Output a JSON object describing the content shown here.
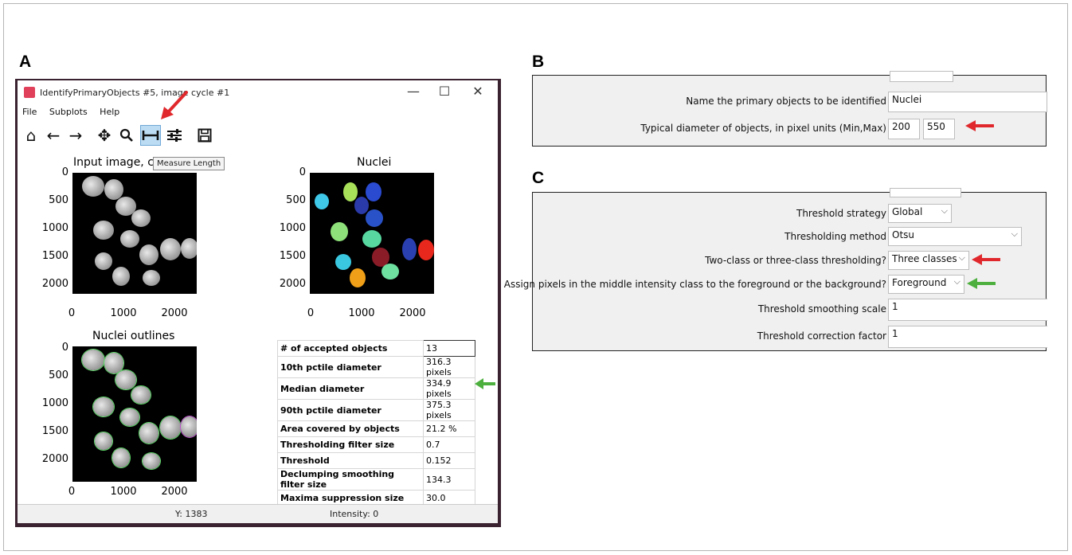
{
  "panels": {
    "a": "A",
    "b": "B",
    "c": "C"
  },
  "window": {
    "title": "IdentifyPrimaryObjects #5, image cycle #1",
    "controls": [
      "—",
      "☐",
      "✕"
    ],
    "menu": [
      "File",
      "Subplots",
      "Help"
    ],
    "toolbar_icons": [
      "home-icon",
      "back-arrow-icon",
      "forward-arrow-icon",
      "pan-icon",
      "zoom-icon",
      "measure-length-icon",
      "configure-subplots-icon",
      "save-icon"
    ],
    "tooltip": "Measure Length",
    "status": {
      "y": "Y: 1383",
      "intensity": "Intensity: 0"
    }
  },
  "plots": {
    "input_title": "Input image, c",
    "nuclei_title": "Nuclei",
    "outlines_title": "Nuclei outlines",
    "yticks": [
      "0",
      "500",
      "1000",
      "1500",
      "2000"
    ],
    "xticks": [
      "0",
      "1000",
      "2000"
    ]
  },
  "stats": [
    {
      "k": "# of accepted objects",
      "v": "13"
    },
    {
      "k": "10th pctile diameter",
      "v": "316.3 pixels"
    },
    {
      "k": "Median diameter",
      "v": "334.9 pixels"
    },
    {
      "k": "90th pctile diameter",
      "v": "375.3 pixels"
    },
    {
      "k": "Area covered by objects",
      "v": "21.2 %"
    },
    {
      "k": "Thresholding filter size",
      "v": "0.7"
    },
    {
      "k": "Threshold",
      "v": "0.152"
    },
    {
      "k": "Declumping smoothing filter size",
      "v": "134.3"
    },
    {
      "k": "Maxima suppression size",
      "v": "30.0"
    }
  ],
  "panel_b": {
    "name_label": "Name the primary objects to be identified",
    "name_value": "Nuclei",
    "diam_label": "Typical diameter of objects, in pixel units (Min,Max)",
    "diam_min": "200",
    "diam_max": "550"
  },
  "panel_c": {
    "strategy_label": "Threshold strategy",
    "strategy_value": "Global",
    "method_label": "Thresholding method",
    "method_value": "Otsu",
    "classes_label": "Two-class or three-class thresholding?",
    "classes_value": "Three classes",
    "assign_label": "Assign pixels in the middle intensity class to the foreground or the background?",
    "assign_value": "Foreground",
    "smoothing_label": "Threshold smoothing scale",
    "smoothing_value": "1",
    "correction_label": "Threshold correction factor",
    "correction_value": "1"
  },
  "colors": {
    "red_arrow": "#e0282c",
    "green_arrow": "#4caf3e",
    "active_tool": "#bcdcf4"
  }
}
